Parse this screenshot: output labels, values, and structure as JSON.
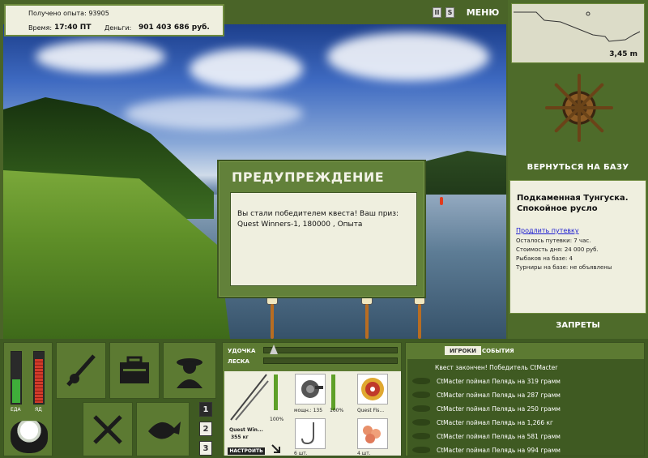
{
  "stats": {
    "experience_label": "Получено опыта:",
    "experience_value": "93905",
    "time_label": "Время:",
    "time_value": "17:40 ПТ",
    "money_label": "Деньги:",
    "money_value": "901 403 686 руб."
  },
  "topbar": {
    "pause_label": "II",
    "sound_label": "S",
    "menu_label": "МЕНЮ"
  },
  "depth": {
    "value": "3,45 m"
  },
  "base": {
    "return_label": "ВЕРНУТЬСЯ НА БАЗУ",
    "place_title": "Подкаменная Тунгуска. Спокойное русло",
    "buy_link": "Продлить путевку",
    "trip_left": "Осталось путевки: 7 час.",
    "day_cost": "Стоимость дня: 24 000 руб.",
    "anglers": "Рыбаков на базе: 4",
    "tournaments": "Турниры на базе: не объявлены",
    "bans_label": "ЗАПРЕТЫ"
  },
  "dialog": {
    "title": "ПРЕДУПРЕЖДЕНИЕ",
    "message": "Вы стали победителем квеста! Ваш приз: Quest Winners-1, 180000 , Опыта"
  },
  "needs": {
    "food_label": "ЕДА",
    "poison_label": "ЯД",
    "food_level": 0.45,
    "poison_level": 0.85
  },
  "slots": [
    "1",
    "2",
    "3"
  ],
  "gear": {
    "rod_label": "УДОЧКА",
    "line_label": "ЛЕСКА",
    "rod_name": "Quest Win...",
    "rod_weight": "355 кг",
    "setup_label": "НАСТРОИТЬ",
    "rod_pct": "100%",
    "reel_power": "мощн.: 135",
    "reel_pct": "100%",
    "line_name": "Quest Fis...",
    "hook_count": "6 шт.",
    "bait_count": "4 шт."
  },
  "events": {
    "tab_players": "ИГРОКИ",
    "tab_events": "СОБЫТИЯ",
    "items": [
      "Квест закончен! Победитель CtMacter",
      "CtMacter поймал Пелядь на 319 грамм",
      "CtMacter поймал Пелядь на 287 грамм",
      "CtMacter поймал Пелядь на 250 грамм",
      "CtMacter поймал Пелядь на 1,266 кг",
      "CtMacter поймал Пелядь на 581 грамм",
      "CtMacter поймал Пелядь на 994 грамм"
    ]
  },
  "colors": {
    "panel_green": "#5c7a32",
    "dark_green": "#3f5a22",
    "paper": "#efefdf"
  }
}
